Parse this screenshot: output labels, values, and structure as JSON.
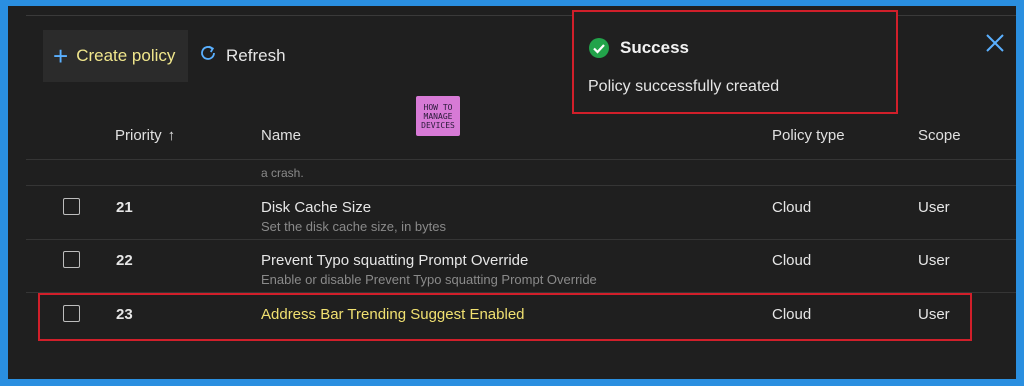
{
  "toolbar": {
    "create_label": "Create policy",
    "refresh_label": "Refresh"
  },
  "toast": {
    "title": "Success",
    "message": "Policy successfully created",
    "icon": "check-circle-icon",
    "status_color": "#22a34a"
  },
  "logo": {
    "line1": "HOW TO",
    "line2": "MANAGE",
    "line3": "DEVICES"
  },
  "table": {
    "headers": {
      "priority": "Priority",
      "name": "Name",
      "policy_type": "Policy type",
      "scope": "Scope"
    },
    "partial_row_text": "a crash.",
    "rows": [
      {
        "priority": "21",
        "name": "Disk Cache Size",
        "description": "Set the disk cache size, in bytes",
        "policy_type": "Cloud",
        "scope": "User"
      },
      {
        "priority": "22",
        "name": "Prevent Typo squatting Prompt Override",
        "description": "Enable or disable Prevent Typo squatting Prompt Override",
        "policy_type": "Cloud",
        "scope": "User"
      },
      {
        "priority": "23",
        "name": "Address Bar Trending Suggest Enabled",
        "description": "",
        "policy_type": "Cloud",
        "scope": "User"
      }
    ]
  },
  "colors": {
    "accent": "#5ab0ff",
    "highlight_border": "#d11f2a",
    "frame": "#2a8fe0"
  }
}
